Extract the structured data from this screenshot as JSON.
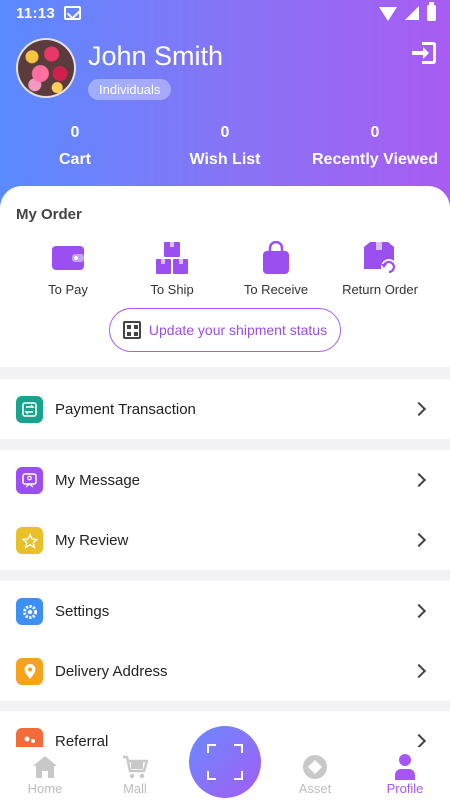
{
  "status": {
    "time": "11:13"
  },
  "profile": {
    "name": "John Smith",
    "badge": "Individuals"
  },
  "stats": [
    {
      "count": "0",
      "label": "Cart"
    },
    {
      "count": "0",
      "label": "Wish List"
    },
    {
      "count": "0",
      "label": "Recently Viewed"
    }
  ],
  "order": {
    "title": "My Order",
    "items": [
      {
        "label": "To Pay",
        "icon": "wallet-icon"
      },
      {
        "label": "To Ship",
        "icon": "boxes-icon"
      },
      {
        "label": "To Receive",
        "icon": "shopping-bag-icon"
      },
      {
        "label": "Return Order",
        "icon": "return-box-icon"
      }
    ],
    "shipment_button": "Update your shipment status"
  },
  "menu": {
    "payment": "Payment Transaction",
    "message": "My Message",
    "review": "My Review",
    "settings": "Settings",
    "delivery": "Delivery Address",
    "referral": "Referral"
  },
  "colors": {
    "accent": "#a855f7",
    "payment_icon": "#1aa38c",
    "message_icon": "#9b4ff0",
    "review_icon": "#e8c02a",
    "settings_icon": "#3d8ef5",
    "delivery_icon": "#f6a21a",
    "referral_icon": "#f26b3a"
  },
  "nav": {
    "home": "Home",
    "mall": "Mall",
    "asset": "Asset",
    "profile": "Profile"
  }
}
